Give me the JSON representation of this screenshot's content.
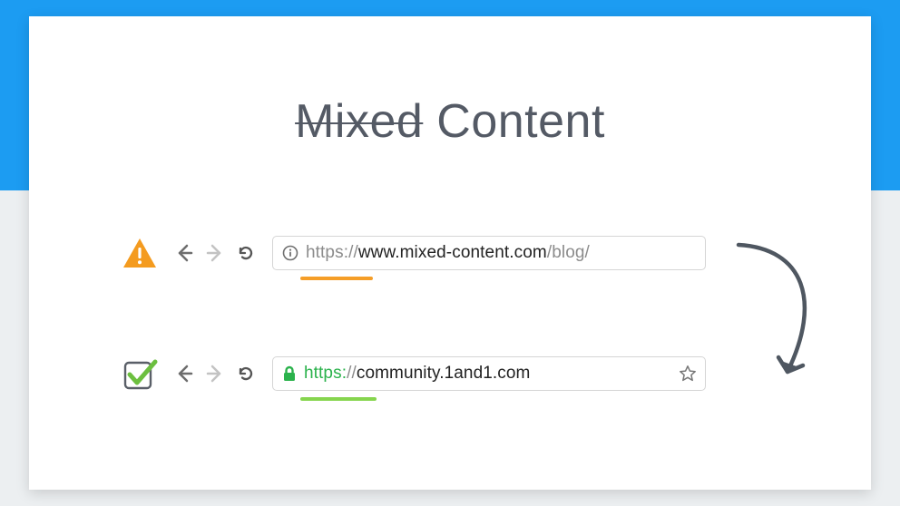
{
  "colors": {
    "accent_blue": "#1c9cf2",
    "warn_orange": "#f49b1f",
    "ok_green": "#2bb24c",
    "underline_orange": "#f59e28",
    "underline_green": "#86d54e",
    "arrow_gray": "#4f5761"
  },
  "title": {
    "strike": "Mixed",
    "rest": "Content"
  },
  "icons": {
    "warning_triangle": "warning-triangle-icon",
    "checkbox_checked": "checkbox-checked-icon",
    "back": "back-arrow-icon",
    "forward": "forward-arrow-icon",
    "reload": "reload-icon",
    "info_circle": "info-circle-icon",
    "lock": "lock-icon",
    "star": "star-outline-icon",
    "flow_arrow": "curved-flow-arrow-icon"
  },
  "rows": {
    "insecure": {
      "status_icon": "warning_triangle",
      "url": {
        "protocol": "https://",
        "host": "www.mixed-content.com",
        "path": "/blog/"
      },
      "site_icon": "info_circle",
      "show_star": false,
      "underline": "orange"
    },
    "secure": {
      "status_icon": "checkbox_checked",
      "url": {
        "protocol": "https:",
        "sep": "//",
        "host": "community.1and1.com",
        "path": ""
      },
      "site_icon": "lock",
      "show_star": true,
      "underline": "green"
    }
  }
}
